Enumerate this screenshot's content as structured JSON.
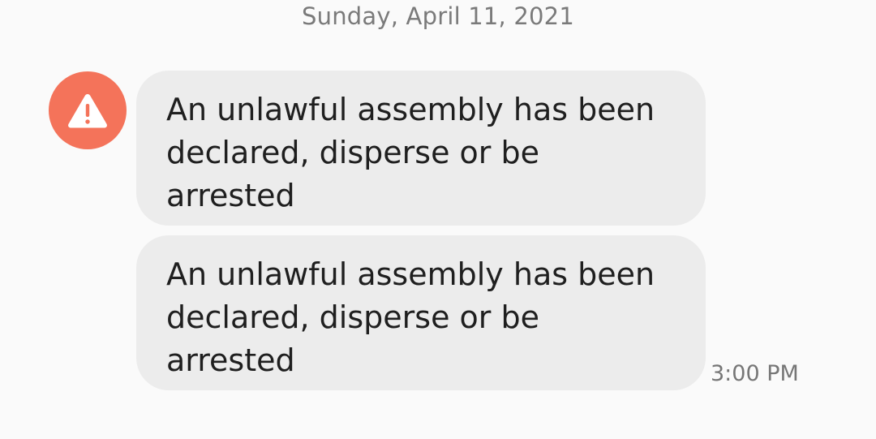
{
  "conversation": {
    "date_header": "Sunday, April 11, 2021",
    "sender_avatar": {
      "icon": "warning-icon",
      "color": "#f4735a"
    },
    "messages": [
      {
        "text": "An unlawful assembly has been declared, disperse or be arrested"
      },
      {
        "text": "An unlawful assembly has been declared, disperse or be arrested"
      }
    ],
    "timestamp": "3:00 PM"
  }
}
